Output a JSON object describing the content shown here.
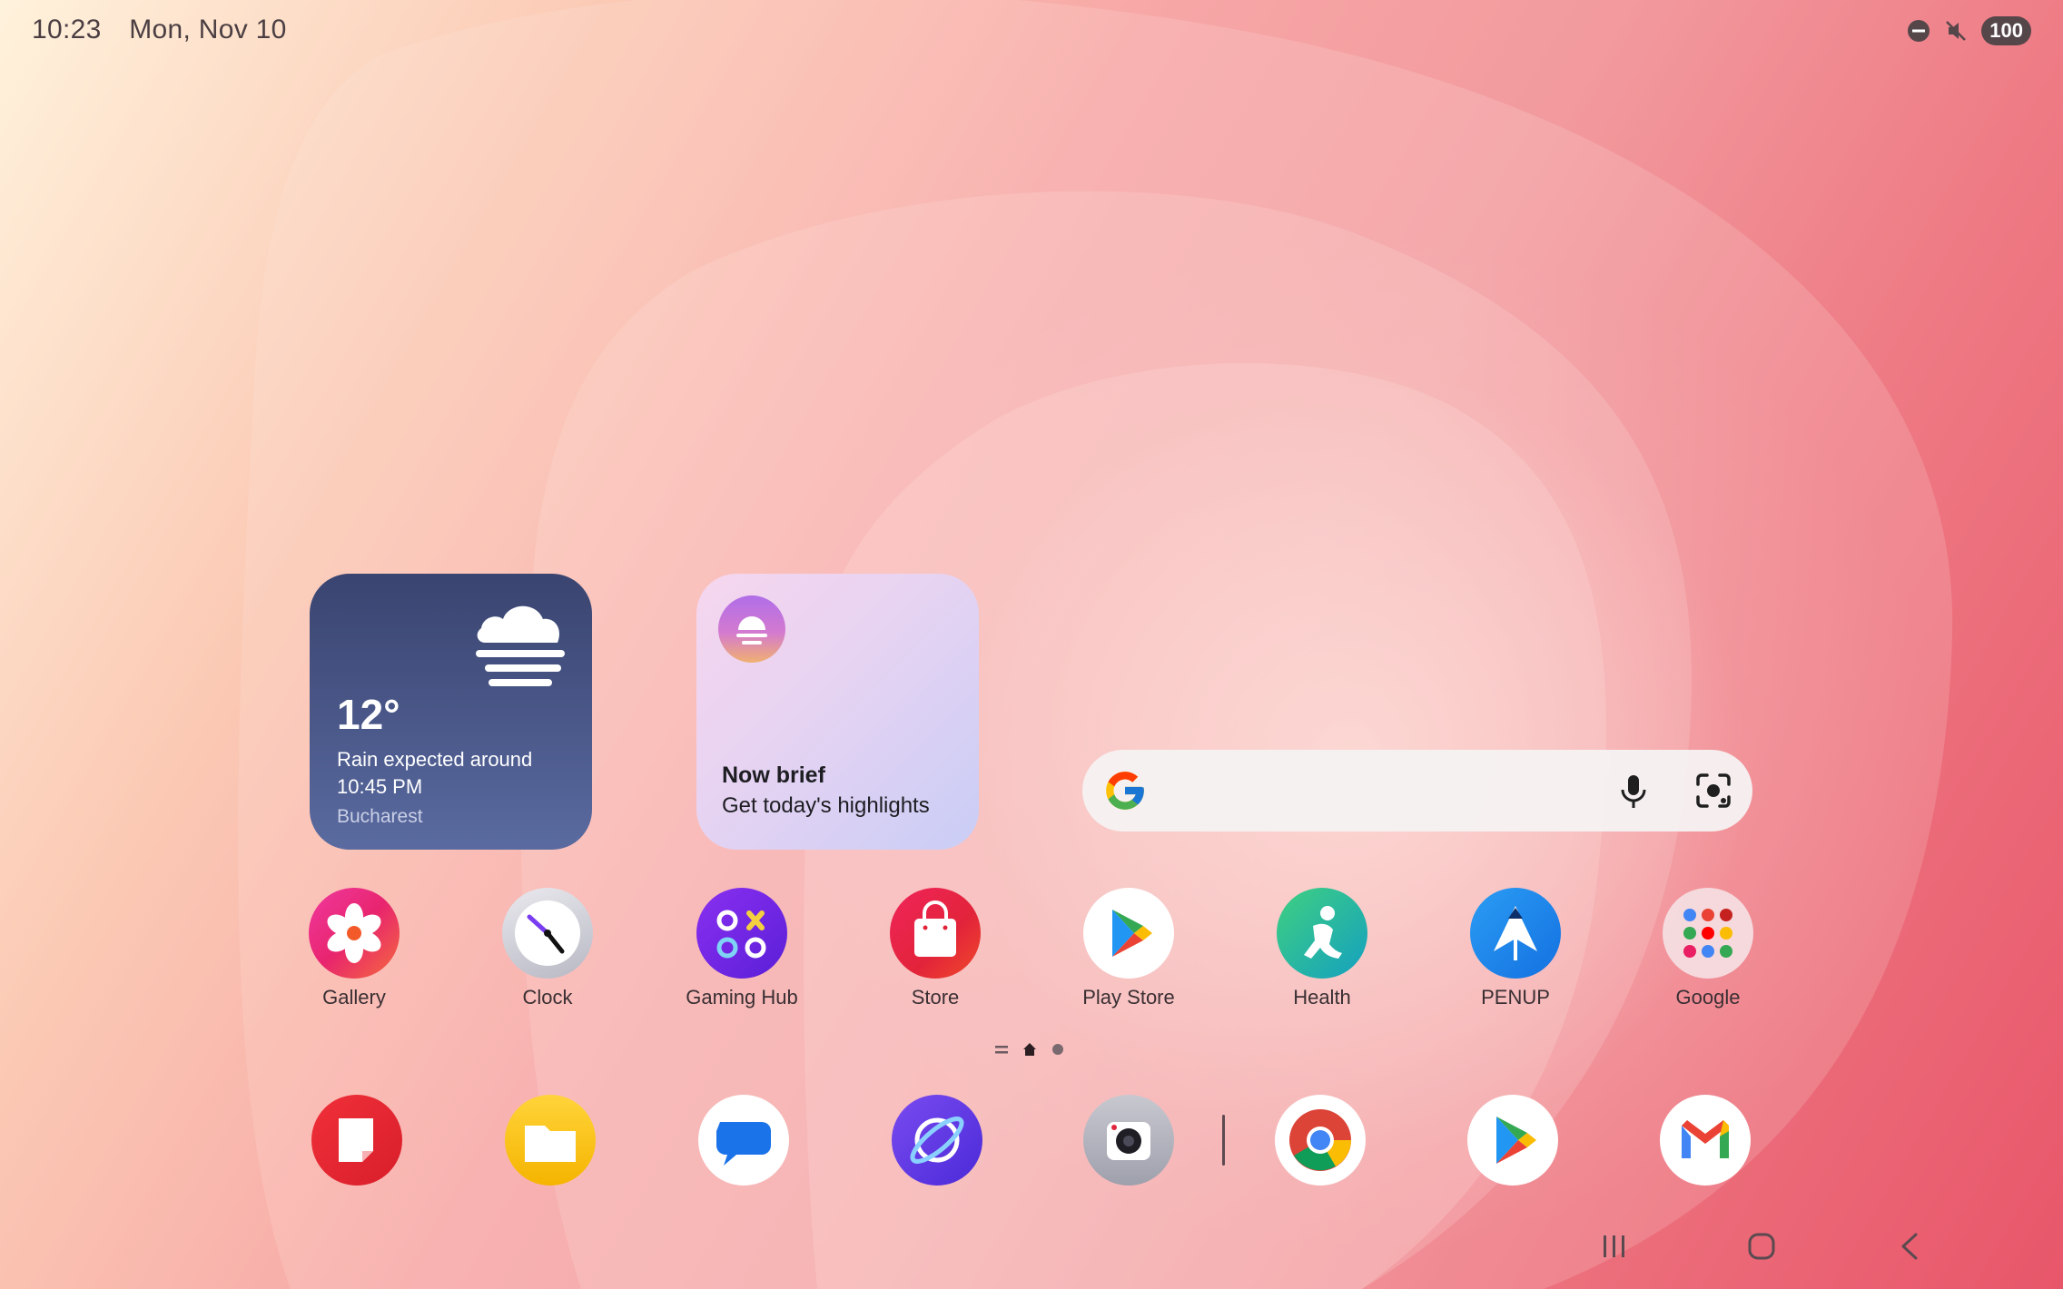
{
  "status_bar": {
    "time": "10:23",
    "date": "Mon, Nov 10",
    "icons": [
      "do-not-disturb-icon",
      "mute-icon"
    ],
    "battery": "100"
  },
  "weather_widget": {
    "temperature": "12°",
    "description": "Rain expected around 10:45 PM",
    "location": "Bucharest",
    "icon": "fog-cloud-icon"
  },
  "now_brief_widget": {
    "title": "Now brief",
    "subtitle": "Get today's highlights"
  },
  "search_bar": {
    "logo": "google-logo",
    "placeholder": "",
    "icons": [
      "mic-icon",
      "lens-icon"
    ]
  },
  "apps": [
    {
      "label": "Gallery",
      "icon": "gallery-icon"
    },
    {
      "label": "Clock",
      "icon": "clock-icon"
    },
    {
      "label": "Gaming Hub",
      "icon": "gaming-hub-icon"
    },
    {
      "label": "Store",
      "icon": "store-icon"
    },
    {
      "label": "Play Store",
      "icon": "play-store-icon"
    },
    {
      "label": "Health",
      "icon": "health-icon"
    },
    {
      "label": "PENUP",
      "icon": "penup-icon"
    },
    {
      "label": "Google",
      "icon": "google-folder-icon"
    }
  ],
  "page_indicator": {
    "pages": [
      "list",
      "home",
      "page"
    ],
    "current": 1
  },
  "dock": [
    {
      "icon": "notes-icon"
    },
    {
      "icon": "files-icon"
    },
    {
      "icon": "messages-icon"
    },
    {
      "icon": "internet-icon"
    },
    {
      "icon": "camera-icon"
    },
    {
      "icon": "chrome-icon"
    },
    {
      "icon": "play-store-icon"
    },
    {
      "icon": "gmail-icon"
    }
  ],
  "nav_bar": [
    "recents-icon",
    "home-icon",
    "back-icon"
  ]
}
